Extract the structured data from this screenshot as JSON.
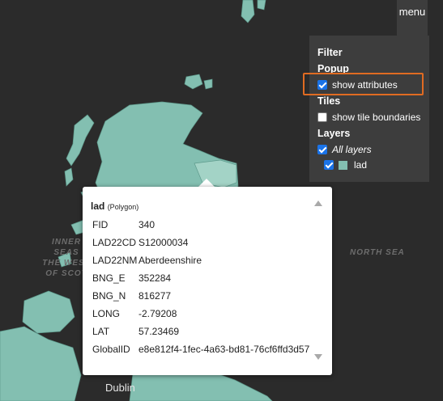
{
  "map": {
    "sea_labels": [
      {
        "lines": [
          "INNER SEAS",
          "THE WEST",
          "OF SCOT"
        ]
      },
      {
        "lines": [
          "NORTH SEA"
        ]
      }
    ],
    "city_label": "Dublin",
    "colors": {
      "land_fill": "#83bfb1",
      "land_stroke": "#5e9a8c",
      "background": "#2b2b2b"
    }
  },
  "menu": {
    "label": "menu"
  },
  "panel": {
    "filter_heading": "Filter",
    "popup_heading": "Popup",
    "show_attributes_label": "show attributes",
    "show_attributes_checked": true,
    "tiles_heading": "Tiles",
    "show_tile_boundaries_label": "show tile boundaries",
    "show_tile_boundaries_checked": false,
    "layers_heading": "Layers",
    "all_layers_label": "All layers",
    "all_layers_checked": true,
    "layer_name": "lad",
    "layer_checked": true,
    "layer_color": "#83bfb1",
    "highlight_color": "#e06b22"
  },
  "popup": {
    "layer": "lad",
    "geometry": "(Polygon)",
    "attributes": [
      {
        "key": "FID",
        "value": "340"
      },
      {
        "key": "LAD22CD",
        "value": "S12000034"
      },
      {
        "key": "LAD22NM",
        "value": "Aberdeenshire"
      },
      {
        "key": "BNG_E",
        "value": "352284"
      },
      {
        "key": "BNG_N",
        "value": "816277"
      },
      {
        "key": "LONG",
        "value": "-2.79208"
      },
      {
        "key": "LAT",
        "value": "57.23469"
      },
      {
        "key": "GlobalID",
        "value": "e8e812f4-1fec-4a63-bd81-76cf6ffd3d57"
      }
    ]
  }
}
